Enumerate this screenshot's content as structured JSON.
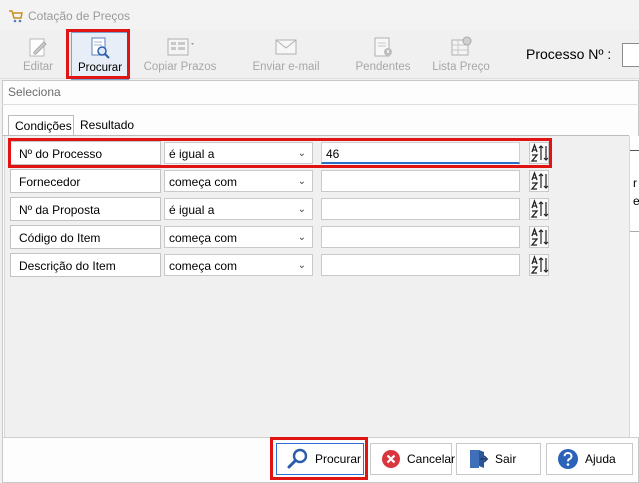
{
  "window": {
    "title": "Cotação de Preços"
  },
  "toolbar": {
    "editar": "Editar",
    "procurar": "Procurar",
    "copiar_prazos": "Copiar Prazos",
    "enviar_email": "Enviar e-mail",
    "pendentes": "Pendentes",
    "lista_preco": "Lista Preço",
    "processo_label": "Processo Nº :"
  },
  "dialog": {
    "title": "Seleciona",
    "tabs": [
      "Condições",
      "Resultado"
    ],
    "rows": [
      {
        "label": "Nº do Processo",
        "operator": "é igual a",
        "value": "46"
      },
      {
        "label": "Fornecedor",
        "operator": "começa com",
        "value": ""
      },
      {
        "label": "Nº da Proposta",
        "operator": "é igual a",
        "value": ""
      },
      {
        "label": "Código do Item",
        "operator": "começa com",
        "value": ""
      },
      {
        "label": "Descrição do Item",
        "operator": "começa com",
        "value": ""
      }
    ],
    "buttons": {
      "procurar": "Procurar",
      "cancelar": "Cancelar",
      "sair": "Sair",
      "ajuda": "Ajuda"
    }
  },
  "background_list": {
    "letters": [
      "r",
      "e"
    ]
  },
  "colors": {
    "highlight": "#e11414",
    "accent": "#2a6fc9",
    "cancel": "#d9363e",
    "help": "#2b63b8"
  }
}
